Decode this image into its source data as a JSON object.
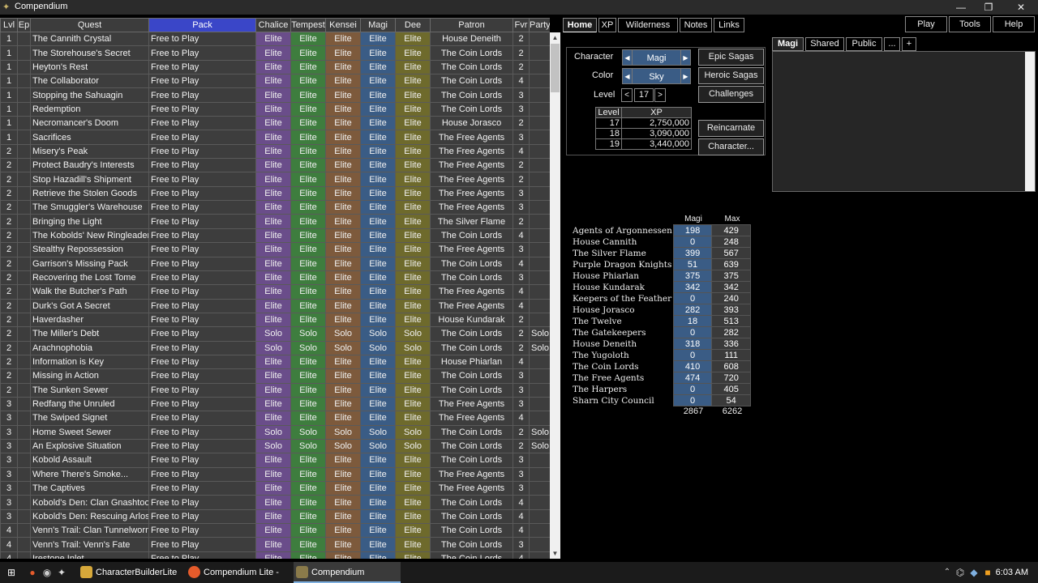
{
  "window": {
    "title": "Compendium",
    "min": "—",
    "max": "❐",
    "close": "✕"
  },
  "columns": [
    "Lvl",
    "Ep",
    "Quest",
    "Pack",
    "Chalice",
    "Tempest",
    "Kensei",
    "Magi",
    "Dee",
    "Patron",
    "Fvr",
    "Party"
  ],
  "quests": [
    [
      "1",
      "",
      "The Cannith Crystal",
      "Free to Play",
      "Elite",
      "Elite",
      "Elite",
      "Elite",
      "Elite",
      "House Deneith",
      "2",
      ""
    ],
    [
      "1",
      "",
      "The Storehouse's Secret",
      "Free to Play",
      "Elite",
      "Elite",
      "Elite",
      "Elite",
      "Elite",
      "The Coin Lords",
      "2",
      ""
    ],
    [
      "1",
      "",
      "Heyton's Rest",
      "Free to Play",
      "Elite",
      "Elite",
      "Elite",
      "Elite",
      "Elite",
      "The Coin Lords",
      "2",
      ""
    ],
    [
      "1",
      "",
      "The Collaborator",
      "Free to Play",
      "Elite",
      "Elite",
      "Elite",
      "Elite",
      "Elite",
      "The Coin Lords",
      "4",
      ""
    ],
    [
      "1",
      "",
      "Stopping the Sahuagin",
      "Free to Play",
      "Elite",
      "Elite",
      "Elite",
      "Elite",
      "Elite",
      "The Coin Lords",
      "3",
      ""
    ],
    [
      "1",
      "",
      "Redemption",
      "Free to Play",
      "Elite",
      "Elite",
      "Elite",
      "Elite",
      "Elite",
      "The Coin Lords",
      "3",
      ""
    ],
    [
      "1",
      "",
      "Necromancer's Doom",
      "Free to Play",
      "Elite",
      "Elite",
      "Elite",
      "Elite",
      "Elite",
      "House Jorasco",
      "2",
      ""
    ],
    [
      "1",
      "",
      "Sacrifices",
      "Free to Play",
      "Elite",
      "Elite",
      "Elite",
      "Elite",
      "Elite",
      "The Free Agents",
      "3",
      ""
    ],
    [
      "2",
      "",
      "Misery's Peak",
      "Free to Play",
      "Elite",
      "Elite",
      "Elite",
      "Elite",
      "Elite",
      "The Free Agents",
      "4",
      ""
    ],
    [
      "2",
      "",
      "Protect Baudry's Interests",
      "Free to Play",
      "Elite",
      "Elite",
      "Elite",
      "Elite",
      "Elite",
      "The Free Agents",
      "2",
      ""
    ],
    [
      "2",
      "",
      "Stop Hazadill's Shipment",
      "Free to Play",
      "Elite",
      "Elite",
      "Elite",
      "Elite",
      "Elite",
      "The Free Agents",
      "2",
      ""
    ],
    [
      "2",
      "",
      "Retrieve the Stolen Goods",
      "Free to Play",
      "Elite",
      "Elite",
      "Elite",
      "Elite",
      "Elite",
      "The Free Agents",
      "3",
      ""
    ],
    [
      "2",
      "",
      "The Smuggler's Warehouse",
      "Free to Play",
      "Elite",
      "Elite",
      "Elite",
      "Elite",
      "Elite",
      "The Free Agents",
      "3",
      ""
    ],
    [
      "2",
      "",
      "Bringing the Light",
      "Free to Play",
      "Elite",
      "Elite",
      "Elite",
      "Elite",
      "Elite",
      "The Silver Flame",
      "2",
      ""
    ],
    [
      "2",
      "",
      "The Kobolds' New Ringleader",
      "Free to Play",
      "Elite",
      "Elite",
      "Elite",
      "Elite",
      "Elite",
      "The Coin Lords",
      "4",
      ""
    ],
    [
      "2",
      "",
      "Stealthy Repossession",
      "Free to Play",
      "Elite",
      "Elite",
      "Elite",
      "Elite",
      "Elite",
      "The Free Agents",
      "3",
      ""
    ],
    [
      "2",
      "",
      "Garrison's Missing Pack",
      "Free to Play",
      "Elite",
      "Elite",
      "Elite",
      "Elite",
      "Elite",
      "The Coin Lords",
      "4",
      ""
    ],
    [
      "2",
      "",
      "Recovering the Lost Tome",
      "Free to Play",
      "Elite",
      "Elite",
      "Elite",
      "Elite",
      "Elite",
      "The Coin Lords",
      "3",
      ""
    ],
    [
      "2",
      "",
      "Walk the Butcher's Path",
      "Free to Play",
      "Elite",
      "Elite",
      "Elite",
      "Elite",
      "Elite",
      "The Free Agents",
      "4",
      ""
    ],
    [
      "2",
      "",
      "Durk's Got A Secret",
      "Free to Play",
      "Elite",
      "Elite",
      "Elite",
      "Elite",
      "Elite",
      "The Free Agents",
      "4",
      ""
    ],
    [
      "2",
      "",
      "Haverdasher",
      "Free to Play",
      "Elite",
      "Elite",
      "Elite",
      "Elite",
      "Elite",
      "House Kundarak",
      "2",
      ""
    ],
    [
      "2",
      "",
      "The Miller's Debt",
      "Free to Play",
      "Solo",
      "Solo",
      "Solo",
      "Solo",
      "Solo",
      "The Coin Lords",
      "2",
      "Solo"
    ],
    [
      "2",
      "",
      "Arachnophobia",
      "Free to Play",
      "Solo",
      "Solo",
      "Solo",
      "Solo",
      "Solo",
      "The Coin Lords",
      "2",
      "Solo"
    ],
    [
      "2",
      "",
      "Information is Key",
      "Free to Play",
      "Elite",
      "Elite",
      "Elite",
      "Elite",
      "Elite",
      "House Phiarlan",
      "4",
      ""
    ],
    [
      "2",
      "",
      "Missing in Action",
      "Free to Play",
      "Elite",
      "Elite",
      "Elite",
      "Elite",
      "Elite",
      "The Coin Lords",
      "3",
      ""
    ],
    [
      "2",
      "",
      "The Sunken Sewer",
      "Free to Play",
      "Elite",
      "Elite",
      "Elite",
      "Elite",
      "Elite",
      "The Coin Lords",
      "3",
      ""
    ],
    [
      "3",
      "",
      "Redfang the Unruled",
      "Free to Play",
      "Elite",
      "Elite",
      "Elite",
      "Elite",
      "Elite",
      "The Free Agents",
      "3",
      ""
    ],
    [
      "3",
      "",
      "The Swiped Signet",
      "Free to Play",
      "Elite",
      "Elite",
      "Elite",
      "Elite",
      "Elite",
      "The Free Agents",
      "4",
      ""
    ],
    [
      "3",
      "",
      "Home Sweet Sewer",
      "Free to Play",
      "Solo",
      "Solo",
      "Solo",
      "Solo",
      "Solo",
      "The Coin Lords",
      "2",
      "Solo"
    ],
    [
      "3",
      "",
      "An Explosive Situation",
      "Free to Play",
      "Solo",
      "Solo",
      "Solo",
      "Solo",
      "Solo",
      "The Coin Lords",
      "2",
      "Solo"
    ],
    [
      "3",
      "",
      "Kobold Assault",
      "Free to Play",
      "Elite",
      "Elite",
      "Elite",
      "Elite",
      "Elite",
      "The Coin Lords",
      "3",
      ""
    ],
    [
      "3",
      "",
      "Where There's Smoke...",
      "Free to Play",
      "Elite",
      "Elite",
      "Elite",
      "Elite",
      "Elite",
      "The Free Agents",
      "3",
      ""
    ],
    [
      "3",
      "",
      "The Captives",
      "Free to Play",
      "Elite",
      "Elite",
      "Elite",
      "Elite",
      "Elite",
      "The Free Agents",
      "3",
      ""
    ],
    [
      "3",
      "",
      "Kobold's Den: Clan Gnashtooth",
      "Free to Play",
      "Elite",
      "Elite",
      "Elite",
      "Elite",
      "Elite",
      "The Coin Lords",
      "4",
      ""
    ],
    [
      "3",
      "",
      "Kobold's Den: Rescuing Arlos",
      "Free to Play",
      "Elite",
      "Elite",
      "Elite",
      "Elite",
      "Elite",
      "The Coin Lords",
      "4",
      ""
    ],
    [
      "4",
      "",
      "Venn's Trail: Clan Tunnelworm",
      "Free to Play",
      "Elite",
      "Elite",
      "Elite",
      "Elite",
      "Elite",
      "The Coin Lords",
      "4",
      ""
    ],
    [
      "4",
      "",
      "Venn's Trail: Venn's Fate",
      "Free to Play",
      "Elite",
      "Elite",
      "Elite",
      "Elite",
      "Elite",
      "The Coin Lords",
      "3",
      ""
    ],
    [
      "4",
      "",
      "Irestone Inlet",
      "Free to Play",
      "Elite",
      "Elite",
      "Elite",
      "Elite",
      "Elite",
      "The Coin Lords",
      "4",
      ""
    ]
  ],
  "main_tabs": [
    "Home",
    "XP",
    "Wilderness",
    "Notes",
    "Links"
  ],
  "top_buttons": [
    "Play",
    "Tools",
    "Help"
  ],
  "character": {
    "character_label": "Character",
    "character_value": "Magi",
    "color_label": "Color",
    "color_value": "Sky",
    "level_label": "Level",
    "level_value": "17",
    "prev": "<",
    "next": ">",
    "arrow_left": "◀",
    "arrow_right": "▶",
    "xp_headers": [
      "Level",
      "XP"
    ],
    "xp_rows": [
      [
        "17",
        "2,750,000"
      ],
      [
        "18",
        "3,090,000"
      ],
      [
        "19",
        "3,440,000"
      ]
    ]
  },
  "side_buttons": [
    "Epic Sagas",
    "Heroic Sagas",
    "Challenges",
    "Reincarnate",
    "Character..."
  ],
  "note_tabs": [
    "Magi",
    "Shared",
    "Public",
    "...",
    "+"
  ],
  "favor": {
    "col_current": "Magi",
    "col_max": "Max",
    "rows": [
      [
        "Agents of Argonnessen",
        "198",
        "429"
      ],
      [
        "House Cannith",
        "0",
        "248"
      ],
      [
        "The Silver Flame",
        "399",
        "567"
      ],
      [
        "Purple Dragon Knights",
        "51",
        "639"
      ],
      [
        "House Phiarlan",
        "375",
        "375"
      ],
      [
        "House Kundarak",
        "342",
        "342"
      ],
      [
        "Keepers of the Feather",
        "0",
        "240"
      ],
      [
        "House Jorasco",
        "282",
        "393"
      ],
      [
        "The Twelve",
        "18",
        "513"
      ],
      [
        "The Gatekeepers",
        "0",
        "282"
      ],
      [
        "House Deneith",
        "318",
        "336"
      ],
      [
        "The Yugoloth",
        "0",
        "111"
      ],
      [
        "The Coin Lords",
        "410",
        "608"
      ],
      [
        "The Free Agents",
        "474",
        "720"
      ],
      [
        "The Harpers",
        "0",
        "405"
      ],
      [
        "Sharn City Council",
        "0",
        "54"
      ]
    ],
    "total_current": "2867",
    "total_max": "6262"
  },
  "taskbar": {
    "items": [
      "CharacterBuilderLite",
      "Compendium Lite - R...",
      "Compendium"
    ],
    "clock": "6:03 AM"
  }
}
